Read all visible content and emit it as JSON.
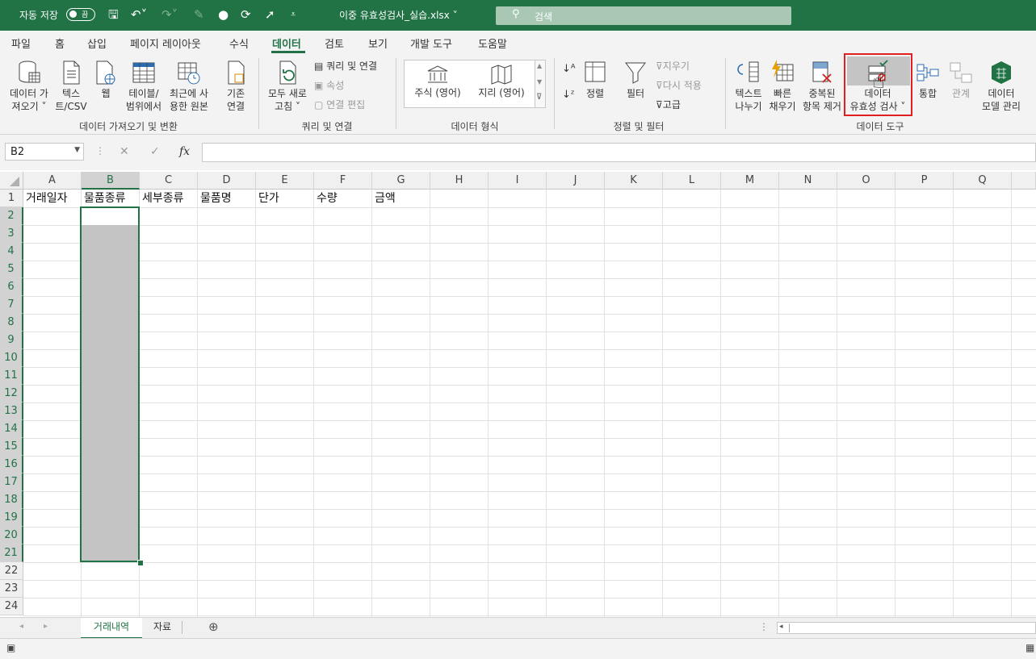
{
  "titlebar": {
    "autosave_label": "자동 저장",
    "autosave_state": "끔",
    "filename": "이중 유효성검사_실습.xlsx",
    "search_placeholder": "검색"
  },
  "tabs": [
    "파일",
    "홈",
    "삽입",
    "페이지 레이아웃",
    "수식",
    "데이터",
    "검토",
    "보기",
    "개발 도구",
    "도움말"
  ],
  "active_tab": "데이터",
  "ribbon": {
    "get_data": "데이터 가\n져오기 ˅",
    "text_csv": "텍스\n트/CSV",
    "web": "웹",
    "table_range": "테이블/\n범위에서",
    "recent_sources": "최근에 사\n용한 원본",
    "existing_conn": "기존\n연결",
    "group_get_transform": "데이터 가져오기 및 변환",
    "refresh_all": "모두 새로\n고침 ˅",
    "queries_conn": "쿼리 및 연결",
    "properties": "속성",
    "edit_links": "연결 편집",
    "group_queries": "쿼리 및 연결",
    "stocks": "주식 (영어)",
    "geography": "지리 (영어)",
    "group_data_types": "데이터 형식",
    "sort": "정렬",
    "filter": "필터",
    "clear": "지우기",
    "reapply": "다시 적용",
    "advanced": "고급",
    "group_sort_filter": "정렬 및 필터",
    "text_to_columns": "텍스트\n나누기",
    "flash_fill": "빠른\n채우기",
    "remove_dupes": "중복된\n항목 제거",
    "data_validation": "데이터\n유효성 검사 ˅",
    "consolidate": "통합",
    "relationships": "관계",
    "data_model": "데이터\n모델 관리",
    "group_data_tools": "데이터 도구"
  },
  "formula_bar": {
    "name_box": "B2",
    "cancel": "✕",
    "enter": "✓",
    "fx": "fx",
    "content": ""
  },
  "columns": [
    "A",
    "B",
    "C",
    "D",
    "E",
    "F",
    "G",
    "H",
    "I",
    "J",
    "K",
    "L",
    "M",
    "N",
    "O",
    "P",
    "Q"
  ],
  "rows": [
    "1",
    "2",
    "3",
    "4",
    "5",
    "6",
    "7",
    "8",
    "9",
    "10",
    "11",
    "12",
    "13",
    "14",
    "15",
    "16",
    "17",
    "18",
    "19",
    "20",
    "21",
    "22",
    "23",
    "24"
  ],
  "header_row": [
    "거래일자",
    "물품종류",
    "세부종류",
    "물품명",
    "단가",
    "수량",
    "금액"
  ],
  "selection": {
    "range": "B2:B21",
    "active_cell": "B2"
  },
  "sheets": [
    "거래내역",
    "자료"
  ],
  "active_sheet": "거래내역",
  "colors": {
    "accent": "#217346",
    "highlight": "#e02020",
    "selection_fill": "#c4c4c4"
  }
}
